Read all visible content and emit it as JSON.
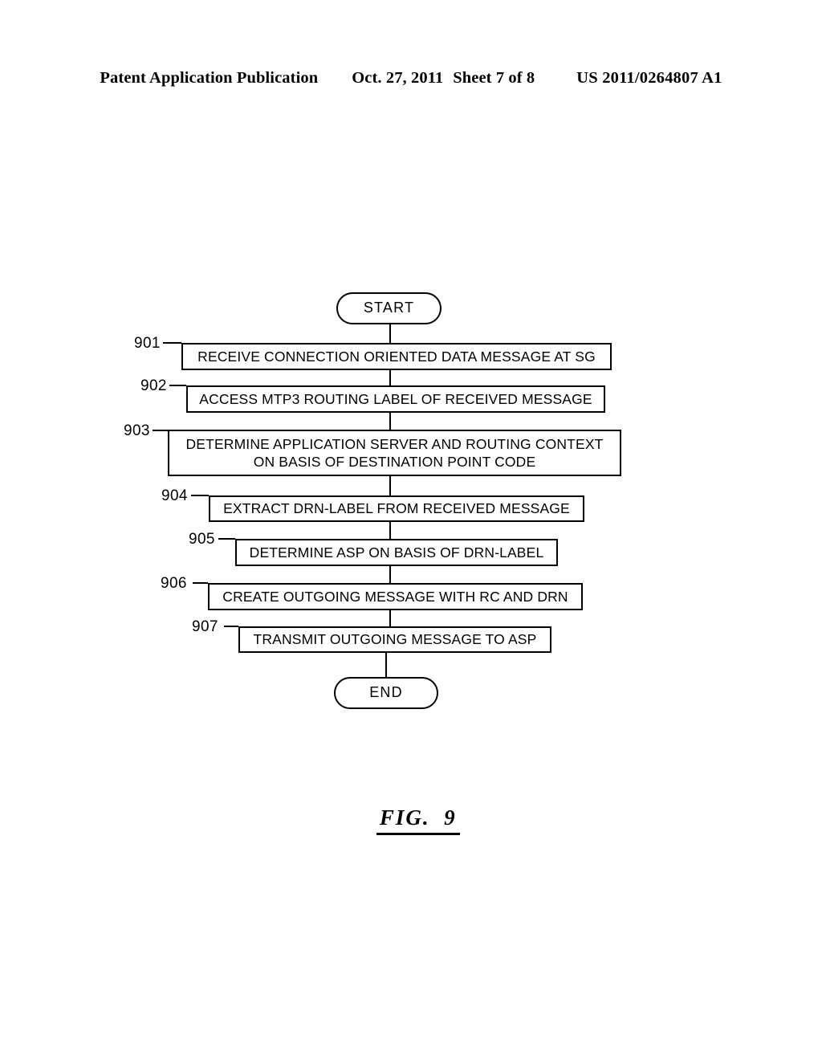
{
  "header": {
    "publication": "Patent Application Publication",
    "date": "Oct. 27, 2011",
    "sheet": "Sheet 7 of 8",
    "patent_number": "US 2011/0264807 A1"
  },
  "figure": {
    "caption": "FIG.  9",
    "start_label": "START",
    "end_label": "END",
    "steps": [
      {
        "ref": "901",
        "line1": "RECEIVE CONNECTION ORIENTED DATA MESSAGE AT SG",
        "line2": ""
      },
      {
        "ref": "902",
        "line1": "ACCESS MTP3 ROUTING LABEL OF RECEIVED MESSAGE",
        "line2": ""
      },
      {
        "ref": "903",
        "line1": "DETERMINE APPLICATION SERVER AND ROUTING CONTEXT",
        "line2": "ON BASIS OF DESTINATION POINT CODE"
      },
      {
        "ref": "904",
        "line1": "EXTRACT DRN-LABEL FROM RECEIVED MESSAGE",
        "line2": ""
      },
      {
        "ref": "905",
        "line1": "DETERMINE ASP ON BASIS OF DRN-LABEL",
        "line2": ""
      },
      {
        "ref": "906",
        "line1": "CREATE OUTGOING MESSAGE WITH RC AND DRN",
        "line2": ""
      },
      {
        "ref": "907",
        "line1": "TRANSMIT OUTGOING MESSAGE TO ASP",
        "line2": ""
      }
    ]
  },
  "colors": {
    "ink": "#000000",
    "paper": "#ffffff"
  }
}
